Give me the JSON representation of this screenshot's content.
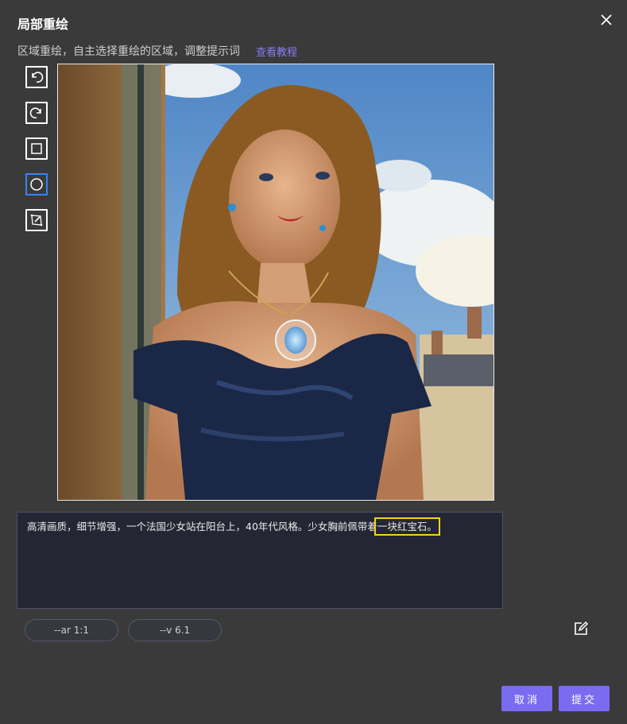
{
  "dialog": {
    "title": "局部重绘",
    "subtitle": "区域重绘，自主选择重绘的区域，调整提示词",
    "tutorial_link": "查看教程"
  },
  "toolbar": {
    "tools": [
      {
        "name": "undo",
        "icon": "undo-icon"
      },
      {
        "name": "redo",
        "icon": "redo-icon"
      },
      {
        "name": "rectangle",
        "icon": "rectangle-select-icon"
      },
      {
        "name": "ellipse",
        "icon": "circle-select-icon",
        "active": true
      },
      {
        "name": "lasso",
        "icon": "lasso-select-icon"
      }
    ]
  },
  "image": {
    "description_icon": "portrait-image",
    "selection_shape": "circle"
  },
  "prompt": {
    "text_before": "高清画质，细节增强，一个法国少女站在阳台上，40年代风格。少女胸前佩带着",
    "text_highlight": "一块红宝石。"
  },
  "params": {
    "aspect_ratio": "--ar 1:1",
    "version": "--v 6.1"
  },
  "buttons": {
    "cancel": "取消",
    "submit": "提交"
  },
  "colors": {
    "background": "#3a3a3a",
    "accent": "#7a6cf0",
    "highlight": "#f4d21f",
    "active_tool": "#3c82f6"
  }
}
